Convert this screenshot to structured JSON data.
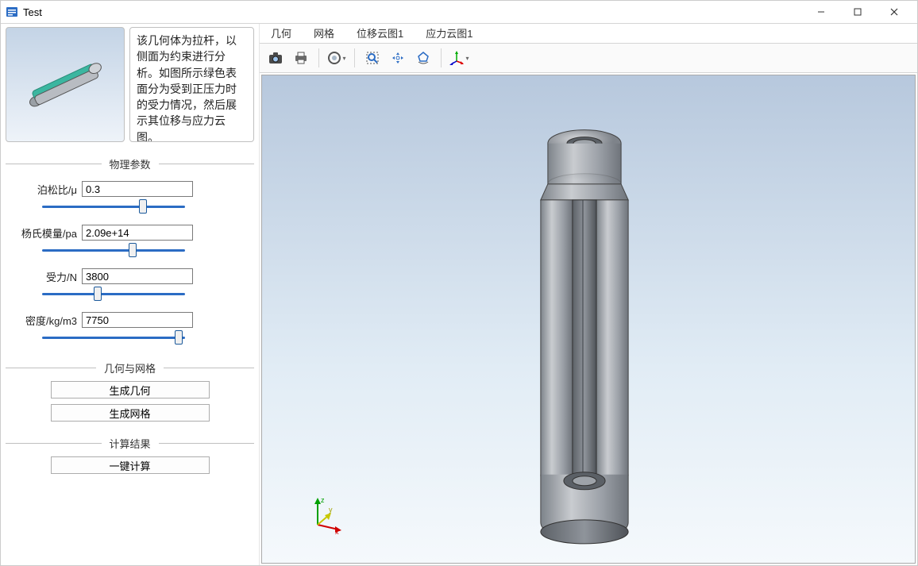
{
  "window": {
    "title": "Test"
  },
  "description": "该几何体为拉杆，以侧面为约束进行分析。如图所示绿色表面分为受到正压力时的受力情况，然后展示其位移与应力云图。",
  "sections": {
    "params_title": "物理参数",
    "geom_title": "几何与网格",
    "result_title": "计算结果"
  },
  "params": {
    "poisson": {
      "label": "泊松比/μ",
      "value": "0.3",
      "slider": 72
    },
    "young": {
      "label": "杨氏模量/pa",
      "value": "2.09e+14",
      "slider": 64
    },
    "force": {
      "label": "受力/N",
      "value": "3800",
      "slider": 38
    },
    "density": {
      "label": "密度/kg/m3",
      "value": "7750",
      "slider": 98
    }
  },
  "buttons": {
    "gen_geom": "生成几何",
    "gen_mesh": "生成网格",
    "compute": "一键计算"
  },
  "tabs": {
    "geom": "几何",
    "mesh": "网格",
    "disp": "位移云图1",
    "stress": "应力云图1"
  },
  "icons": {
    "camera": "camera-icon",
    "print": "print-icon",
    "shade": "shade-icon",
    "zoom": "zoom-icon",
    "pan": "pan-icon",
    "rotate": "rotate-icon",
    "axis": "axis-icon"
  },
  "colors": {
    "accent": "#2b6cc4",
    "bg_top": "#b7c8dd",
    "bg_bottom": "#f5f9fc"
  }
}
